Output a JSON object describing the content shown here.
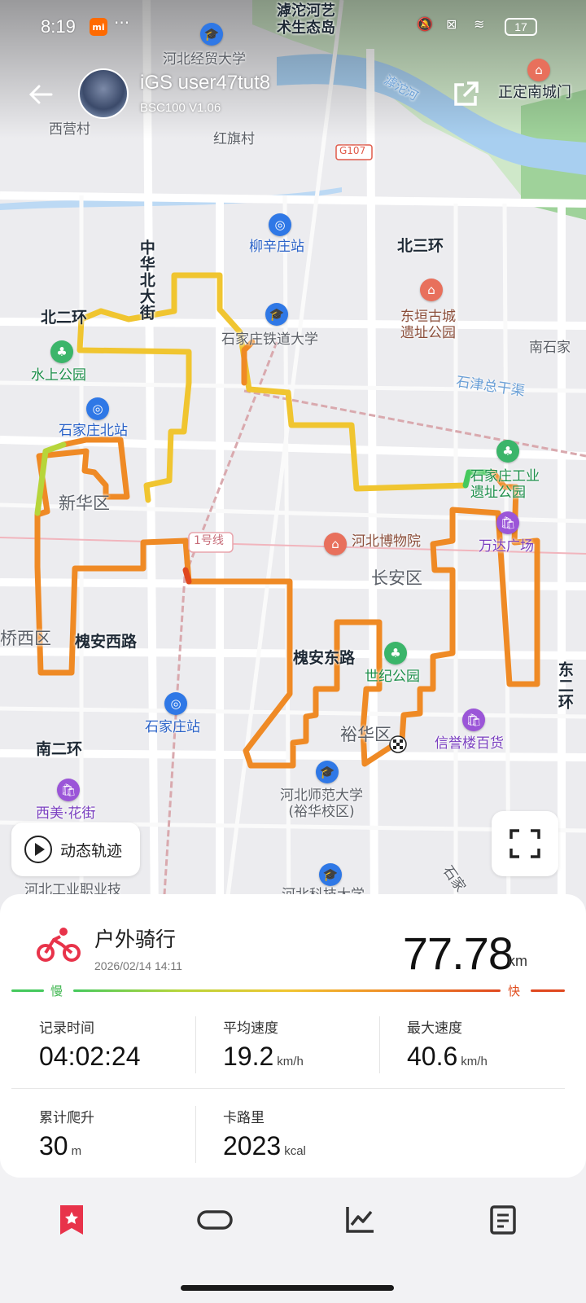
{
  "status_bar": {
    "time": "8:19",
    "app_badge": "mi",
    "more": "···",
    "battery": "17",
    "signal_sub": "6"
  },
  "header": {
    "user_name": "iGS user47tut8",
    "device": "BSC100  V1.06"
  },
  "map": {
    "labels": {
      "hutuo_art": "滹沱河艺\n术生态岛",
      "hebei_econ_uni": "河北经贸大学",
      "xiying": "西营村",
      "hongqi": "红旗村",
      "g107": "G107",
      "hutuo_river": "滹沱河",
      "zhengding": "正定南城门",
      "liuxinzhuang": "柳辛庄站",
      "beisanhuan": "北三环",
      "zhonghua_north": "中华北大街",
      "beierhuan": "北二环",
      "railway_uni": "石家庄铁道大学",
      "donghuan_ruins": "东垣古城\n遗址公园",
      "nanshijia": "南石家",
      "shuishang_park": "水上公园",
      "shijin_canal": "石津总干渠",
      "north_station": "石家庄北站",
      "industrial_park": "石家庄工业\n遗址公园",
      "xinhua_district": "新华区",
      "line1": "1号线",
      "hebei_museum": "河北博物院",
      "wanda": "万达广场",
      "changan_district": "长安区",
      "qiaoxi_district": "桥西区",
      "huaian_west": "槐安西路",
      "huaian_east": "槐安东路",
      "century_park": "世纪公园",
      "dong_er_huan": "东二环",
      "sjz_station": "石家庄站",
      "xinyu_mall": "信誉楼百货",
      "yuhua_district": "裕华区",
      "nan_er_huan": "南二环",
      "normal_uni": "河北师范大学\n(裕华校区)",
      "ximei": "西美·花街",
      "hebei_industrial": "河北工业职业技",
      "hebei_tech": "河北科技大学",
      "shi_bottom": "石家"
    },
    "speed_colors": [
      "#45c95d",
      "#b7d53a",
      "#f0c530",
      "#ef8a25",
      "#e0481f"
    ],
    "play_label": "动态轨迹"
  },
  "activity": {
    "title": "户外骑行",
    "date": "2026/02/14 14:11",
    "distance": "77.78",
    "distance_unit": "km",
    "slow_label": "慢",
    "fast_label": "快",
    "stats": {
      "record_time": {
        "label": "记录时间",
        "value": "04:02:24",
        "unit": ""
      },
      "avg_speed": {
        "label": "平均速度",
        "value": "19.2",
        "unit": "km/h"
      },
      "max_speed": {
        "label": "最大速度",
        "value": "40.6",
        "unit": "km/h"
      },
      "elevation": {
        "label": "累计爬升",
        "value": "30",
        "unit": "m"
      },
      "calories": {
        "label": "卡路里",
        "value": "2023",
        "unit": "kcal"
      }
    },
    "accent_color": "#e8334a"
  },
  "bottom_nav": {
    "items": [
      "bookmark-icon",
      "capsule-icon",
      "chart-icon",
      "document-icon"
    ]
  }
}
